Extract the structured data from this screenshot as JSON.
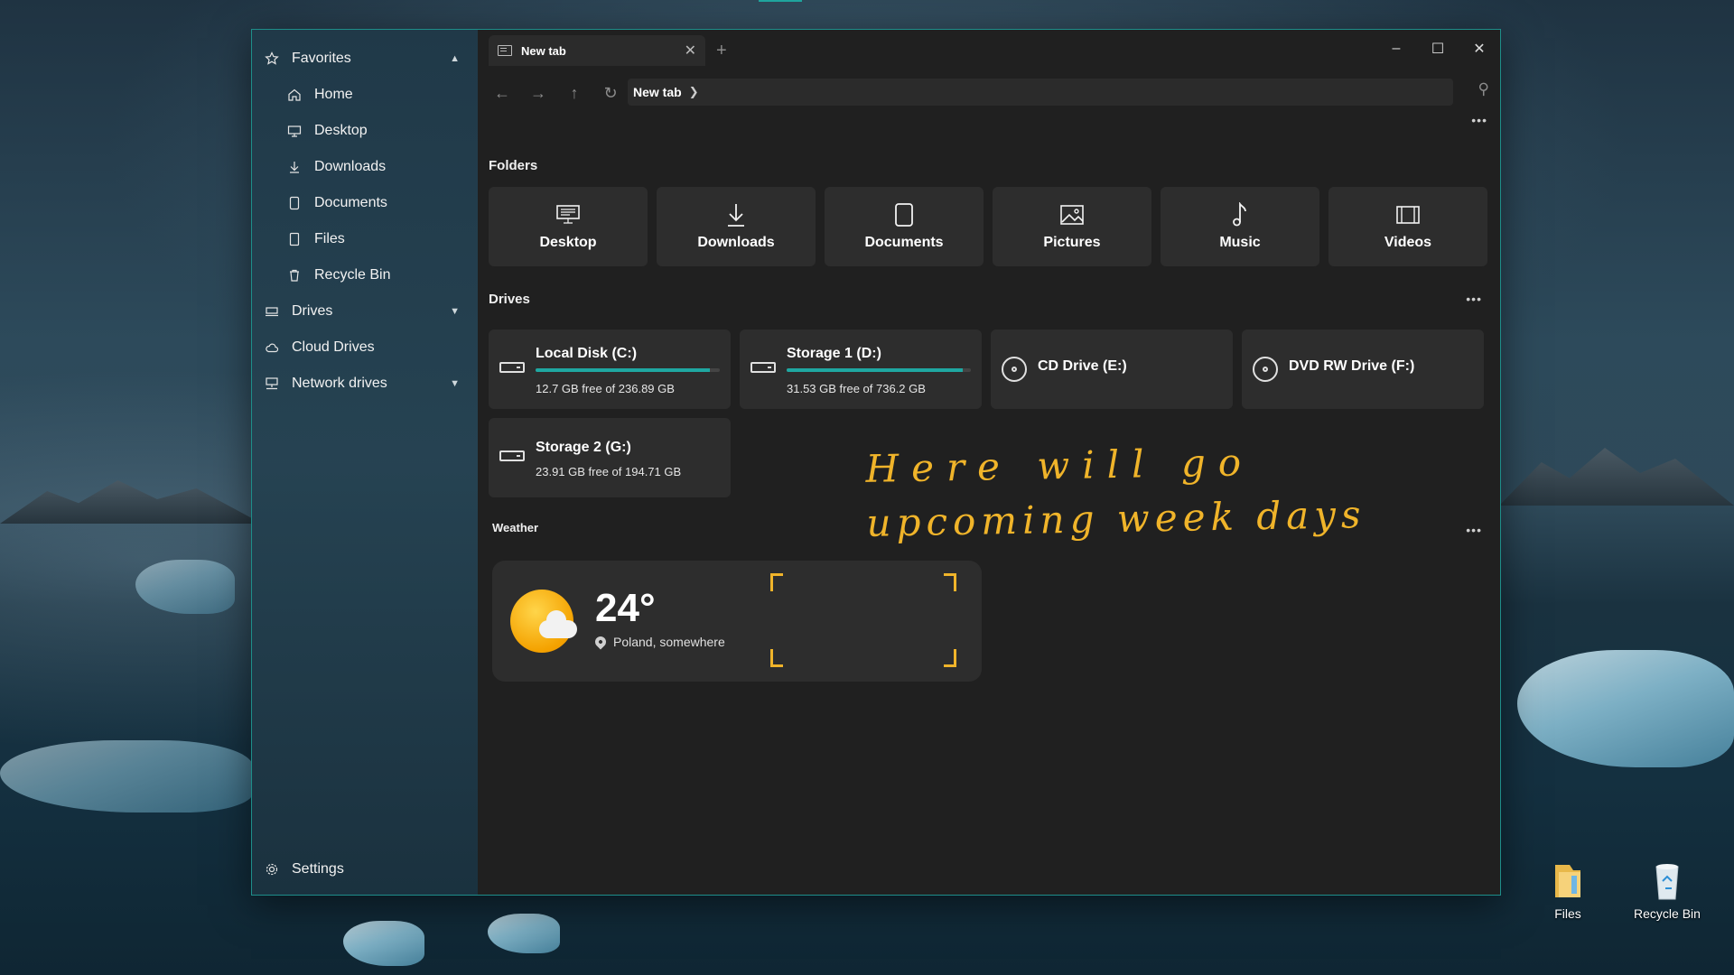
{
  "window": {
    "tab_title": "New tab",
    "address_crumb": "New tab"
  },
  "sidebar": {
    "favorites": {
      "label": "Favorites"
    },
    "items": [
      {
        "label": "Home",
        "icon": "home-icon"
      },
      {
        "label": "Desktop",
        "icon": "desktop-icon"
      },
      {
        "label": "Downloads",
        "icon": "download-icon"
      },
      {
        "label": "Documents",
        "icon": "document-icon"
      },
      {
        "label": "Files",
        "icon": "file-icon"
      },
      {
        "label": "Recycle Bin",
        "icon": "recycle-bin-icon"
      }
    ],
    "drives": {
      "label": "Drives"
    },
    "cloud_drives": {
      "label": "Cloud Drives"
    },
    "network_drives": {
      "label": "Network drives"
    },
    "settings": {
      "label": "Settings"
    }
  },
  "sections": {
    "folders": "Folders",
    "drives": "Drives",
    "weather": "Weather"
  },
  "folders": [
    {
      "label": "Desktop",
      "icon": "desktop-icon"
    },
    {
      "label": "Downloads",
      "icon": "download-icon"
    },
    {
      "label": "Documents",
      "icon": "document-icon"
    },
    {
      "label": "Pictures",
      "icon": "picture-icon"
    },
    {
      "label": "Music",
      "icon": "music-icon"
    },
    {
      "label": "Videos",
      "icon": "video-icon"
    }
  ],
  "drives": [
    {
      "name": "Local Disk (C:)",
      "free": "12.7 GB free of 236.89 GB",
      "used_fraction": 0.946,
      "type": "disk"
    },
    {
      "name": "Storage 1 (D:)",
      "free": "31.53 GB free of 736.2 GB",
      "used_fraction": 0.957,
      "type": "disk"
    },
    {
      "name": "CD Drive (E:)",
      "type": "optical"
    },
    {
      "name": "DVD RW Drive (F:)",
      "type": "optical"
    },
    {
      "name": "Storage 2 (G:)",
      "free": "23.91 GB free of 194.71 GB",
      "type": "disk"
    }
  ],
  "weather": {
    "temperature": "24°",
    "location": "Poland, somewhere",
    "icon": "partly-sunny-icon"
  },
  "annotation": {
    "line1": "Here will go",
    "line2": "upcoming week days"
  },
  "desktop_icons": [
    {
      "label": "Files",
      "icon": "folder-icon"
    },
    {
      "label": "Recycle Bin",
      "icon": "recycle-bin-icon"
    }
  ],
  "colors": {
    "accent": "#1fa7a1",
    "annotation": "#f0b42a",
    "window_bg": "#202020",
    "card_bg": "#2d2d2d"
  }
}
